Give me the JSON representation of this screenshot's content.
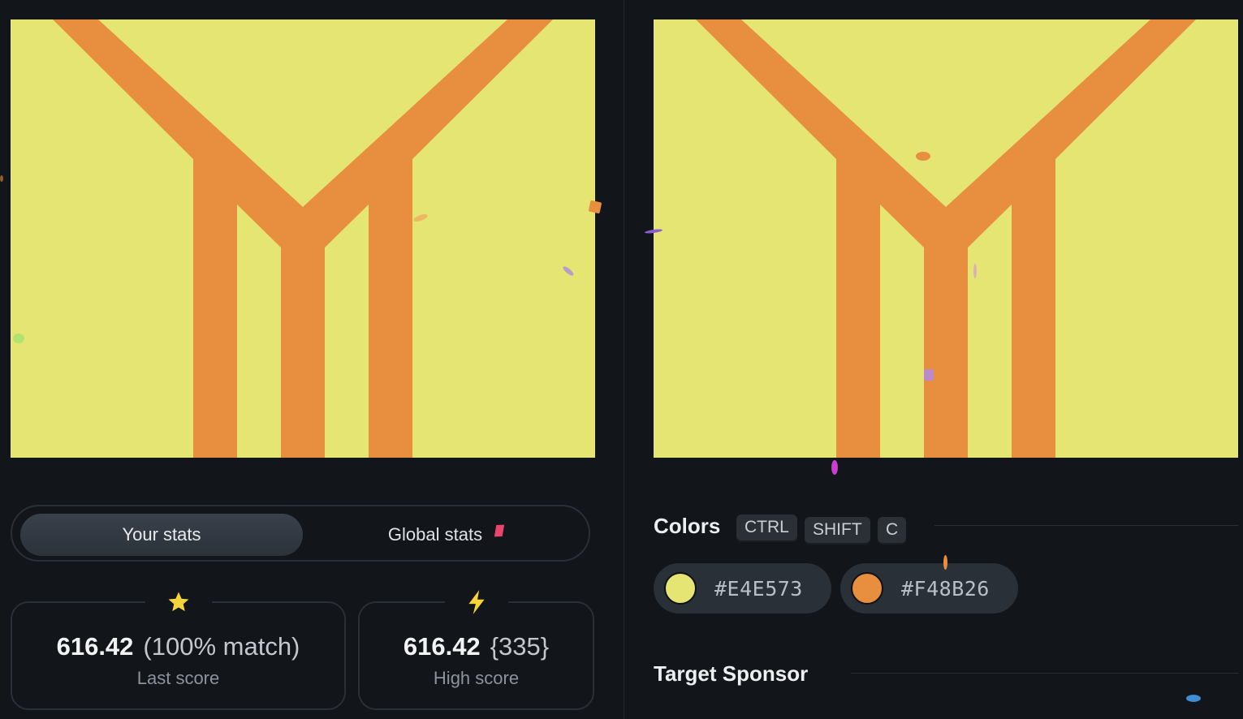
{
  "tabs": {
    "your_stats": "Your stats",
    "global_stats": "Global stats"
  },
  "last_score": {
    "value": "616.42",
    "extra": "(100% match)",
    "label": "Last score"
  },
  "high_score": {
    "value": "616.42",
    "extra": "{335}",
    "label": "High score"
  },
  "colors": {
    "title": "Colors",
    "shortcut_keys": [
      "CTRL",
      "SHIFT",
      "C"
    ],
    "swatches": [
      {
        "hex": "#E4E573",
        "color": "#e4e573"
      },
      {
        "hex": "#F48B26",
        "color": "#e88e3f"
      }
    ]
  },
  "target_sponsor": {
    "title": "Target Sponsor"
  },
  "palette": {
    "background": "#121519",
    "canvas": "#e4e573",
    "shape": "#e88e3f"
  },
  "icons": {
    "last_score": "star-icon",
    "high_score": "lightning-icon",
    "global_tab": "flag-icon"
  }
}
